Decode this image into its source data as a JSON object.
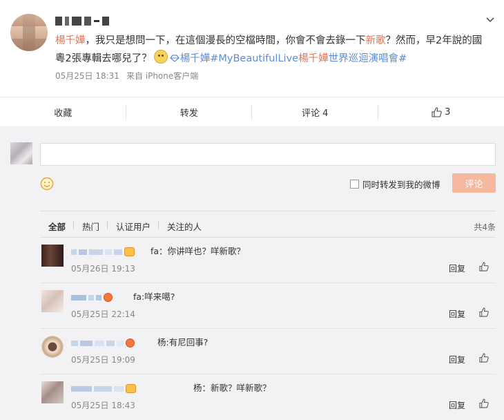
{
  "post": {
    "author_name": "",
    "mention": "楊千嬅",
    "text_part1": "，我只是想問一下，在這個漫長的空檔時間，你會不會去錄一下",
    "highlight_word": "新歌",
    "text_part2": "？然而，早2年說的國粵2張專輯去哪兒了？",
    "topic_prefix": "楊千嬅",
    "topic_tag": "#MyBeautifulLive",
    "topic_name": "楊千嬅",
    "topic_rest": "世界巡迴演唱會#",
    "date": "05月25日 18:31",
    "source": "来自 iPhone客户端"
  },
  "actions": {
    "favorite": "收藏",
    "repost": "转发",
    "comment": "评论 4",
    "like_count": "3"
  },
  "composer": {
    "input_value": "",
    "also_repost_label": "同时转发到我的微博",
    "comment_button": "评论"
  },
  "comment_tabs": {
    "tabs": [
      "全部",
      "热门",
      "认证用户",
      "关注的人"
    ],
    "total": "共4条"
  },
  "comments": [
    {
      "text": "fa：你讲咩也？咩新歌？",
      "time": "05月26日 19:13",
      "reply": "回复"
    },
    {
      "text": "fa:咩来噶?",
      "time": "05月25日 22:14",
      "reply": "回复"
    },
    {
      "text": "杨:有尼回事?",
      "time": "05月25日 19:09",
      "reply": "回复"
    },
    {
      "text": "杨：新歌？咩新歌？",
      "time": "05月25日 18:43",
      "reply": "回复"
    }
  ],
  "colors": {
    "accent_red": "#eb7350",
    "link_blue": "#5d8cd6",
    "button_disabled": "#f7b8a0"
  }
}
